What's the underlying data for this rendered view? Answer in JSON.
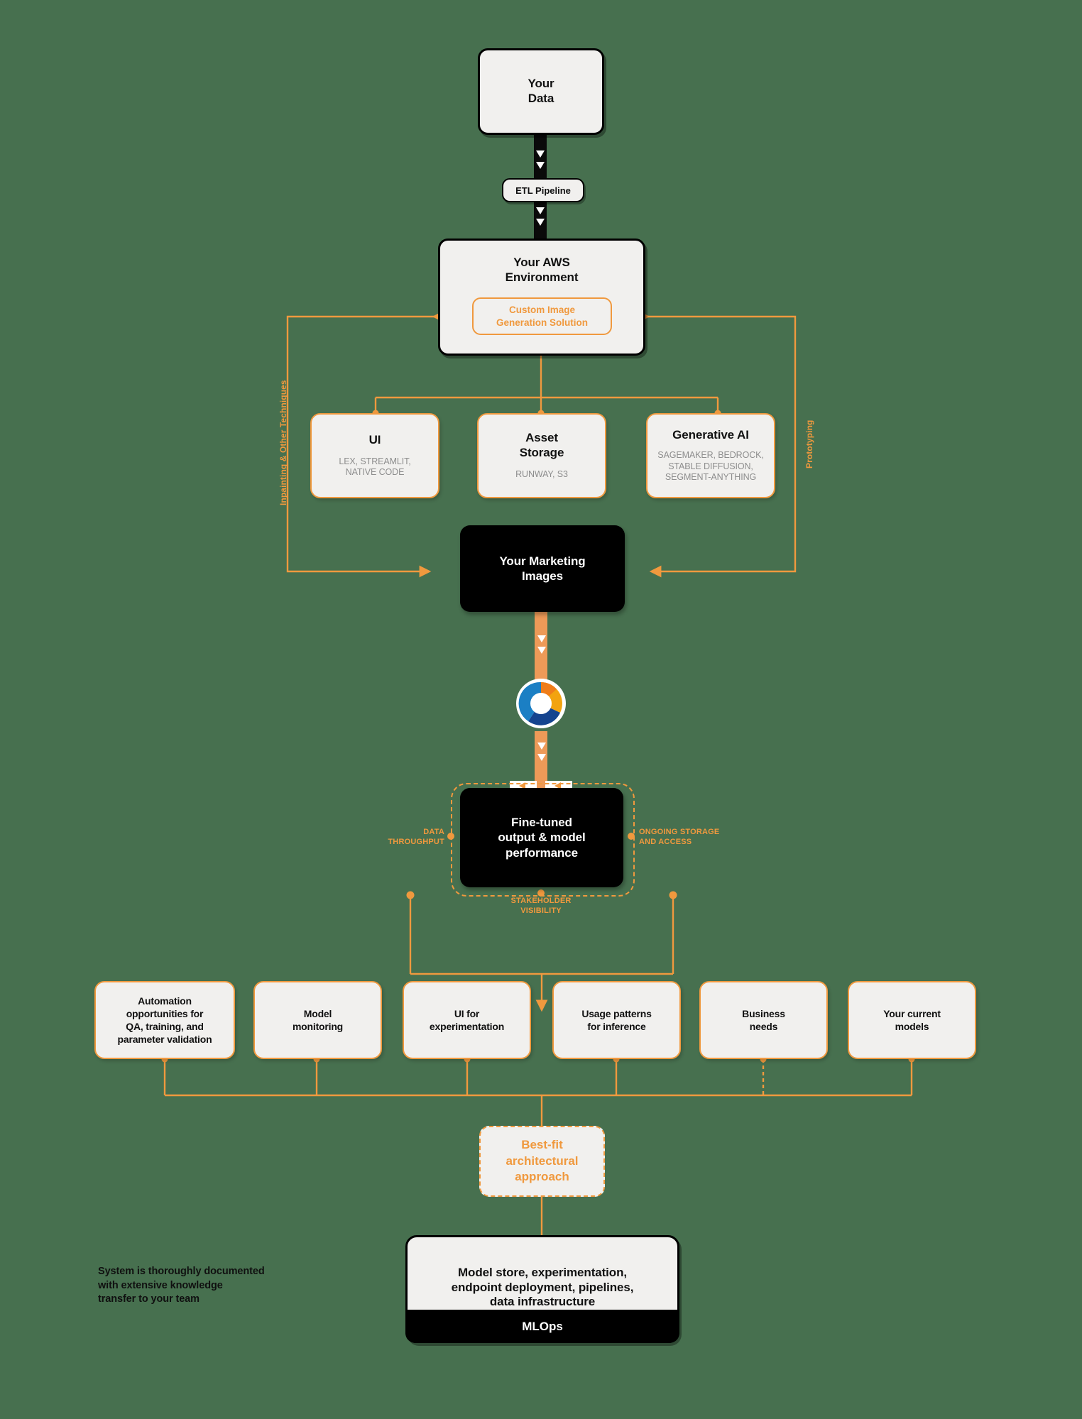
{
  "theme": {
    "background": "#47704f",
    "accent": "#f0993e",
    "panel": "#f1f0ee",
    "dark": "#000000",
    "muted": "#8d8d8d"
  },
  "nodes": {
    "your_data": {
      "title": "Your\nData"
    },
    "etl_pipeline": {
      "label": "ETL Pipeline"
    },
    "aws_environment": {
      "title": "Your AWS\nEnvironment",
      "inner": {
        "label": "Custom Image\nGeneration Solution"
      }
    },
    "ui": {
      "title": "UI",
      "subtitle": "LEX, STREAMLIT,\nNATIVE CODE"
    },
    "asset_storage": {
      "title": "Asset\nStorage",
      "subtitle": "RUNWAY, S3"
    },
    "generative_ai": {
      "title": "Generative AI",
      "subtitle": "SAGEMAKER, BEDROCK,\nSTABLE DIFFUSION,\nSEGMENT-ANYTHING"
    },
    "marketing_images": {
      "title": "Your Marketing\nImages"
    },
    "fine_tuned": {
      "title": "Fine-tuned\noutput & model\nperformance"
    },
    "best_fit": {
      "title": "Best-fit\narchitectural\napproach"
    },
    "mlops": {
      "title": "Model store, experimentation,\nendpoint deployment, pipelines,\ndata infrastructure",
      "footer": "MLOps"
    }
  },
  "loop_labels": {
    "left": "Inpainting & Other Techniques",
    "right": "Prototyping"
  },
  "metric_labels": {
    "left": "DATA\nTHROUGHPUT",
    "right": "ONGOING STORAGE\nAND ACCESS",
    "bottom": "STAKEHOLDER\nVISIBILITY"
  },
  "consideration_boxes": [
    {
      "label": "Automation\nopportunities for\nQA, training, and\nparameter validation"
    },
    {
      "label": "Model\nmonitoring"
    },
    {
      "label": "UI for\nexperimentation"
    },
    {
      "label": "Usage patterns\nfor inference"
    },
    {
      "label": "Business\nneeds"
    },
    {
      "label": "Your current\nmodels"
    }
  ],
  "footnote": "System is thoroughly documented\nwith extensive knowledge\ntransfer to your team"
}
